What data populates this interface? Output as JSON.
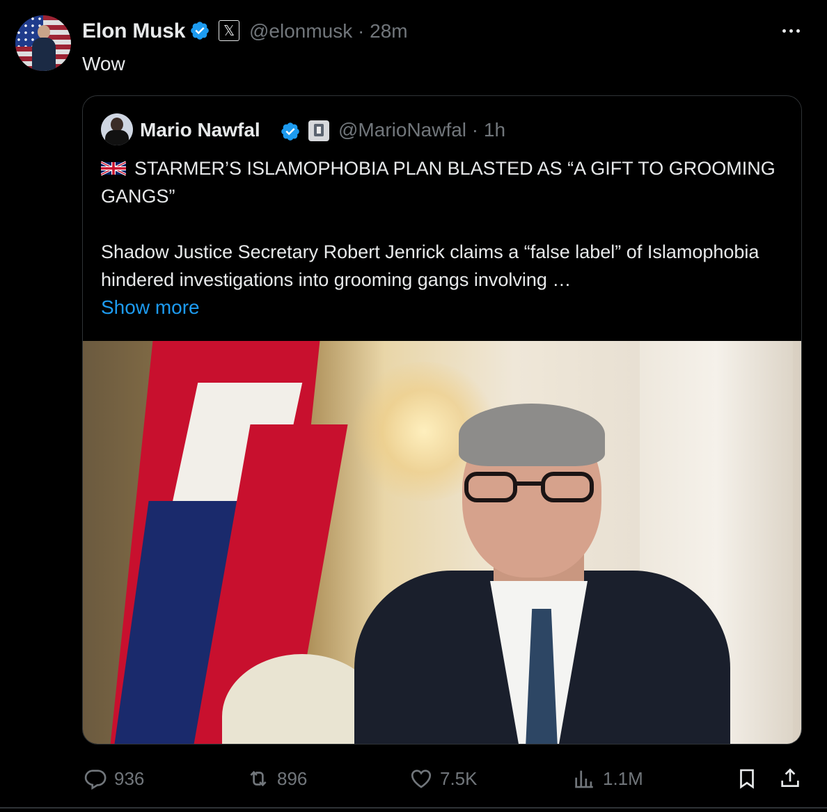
{
  "tweet": {
    "author_name": "Elon Musk",
    "handle_time": "@elonmusk · 28m",
    "text": "Wow",
    "avatar": "avatar",
    "verified_icon": "verified-badge-icon",
    "affiliation_icon": "x-logo-icon",
    "more_icon": "more-options-icon"
  },
  "quote": {
    "author_name": "Mario Nawfal",
    "handle_time": "@MarioNawfal · 1h",
    "headline_flag_icon": "uk-flag-icon",
    "headline": "STARMER’S ISLAMOPHOBIA PLAN BLASTED AS “A GIFT TO GROOMING GANGS”",
    "body": "Shadow Justice Secretary Robert Jenrick claims a “false label” of Islamophobia hindered investigations into grooming gangs involving …",
    "show_more": "Show more",
    "image": "photo of man in glasses and suit in front of Union Jack flag"
  },
  "actions": {
    "replies": "936",
    "reposts": "896",
    "likes": "7.5K",
    "views": "1.1M",
    "reply_icon": "reply-icon",
    "repost_icon": "repost-icon",
    "like_icon": "heart-icon",
    "views_icon": "views-icon",
    "bookmark_icon": "bookmark-icon",
    "share_icon": "share-icon"
  },
  "colors": {
    "background": "#000000",
    "text": "#e7e9ea",
    "muted": "#71767b",
    "accent": "#1d9bf0",
    "border": "#2f3336"
  }
}
